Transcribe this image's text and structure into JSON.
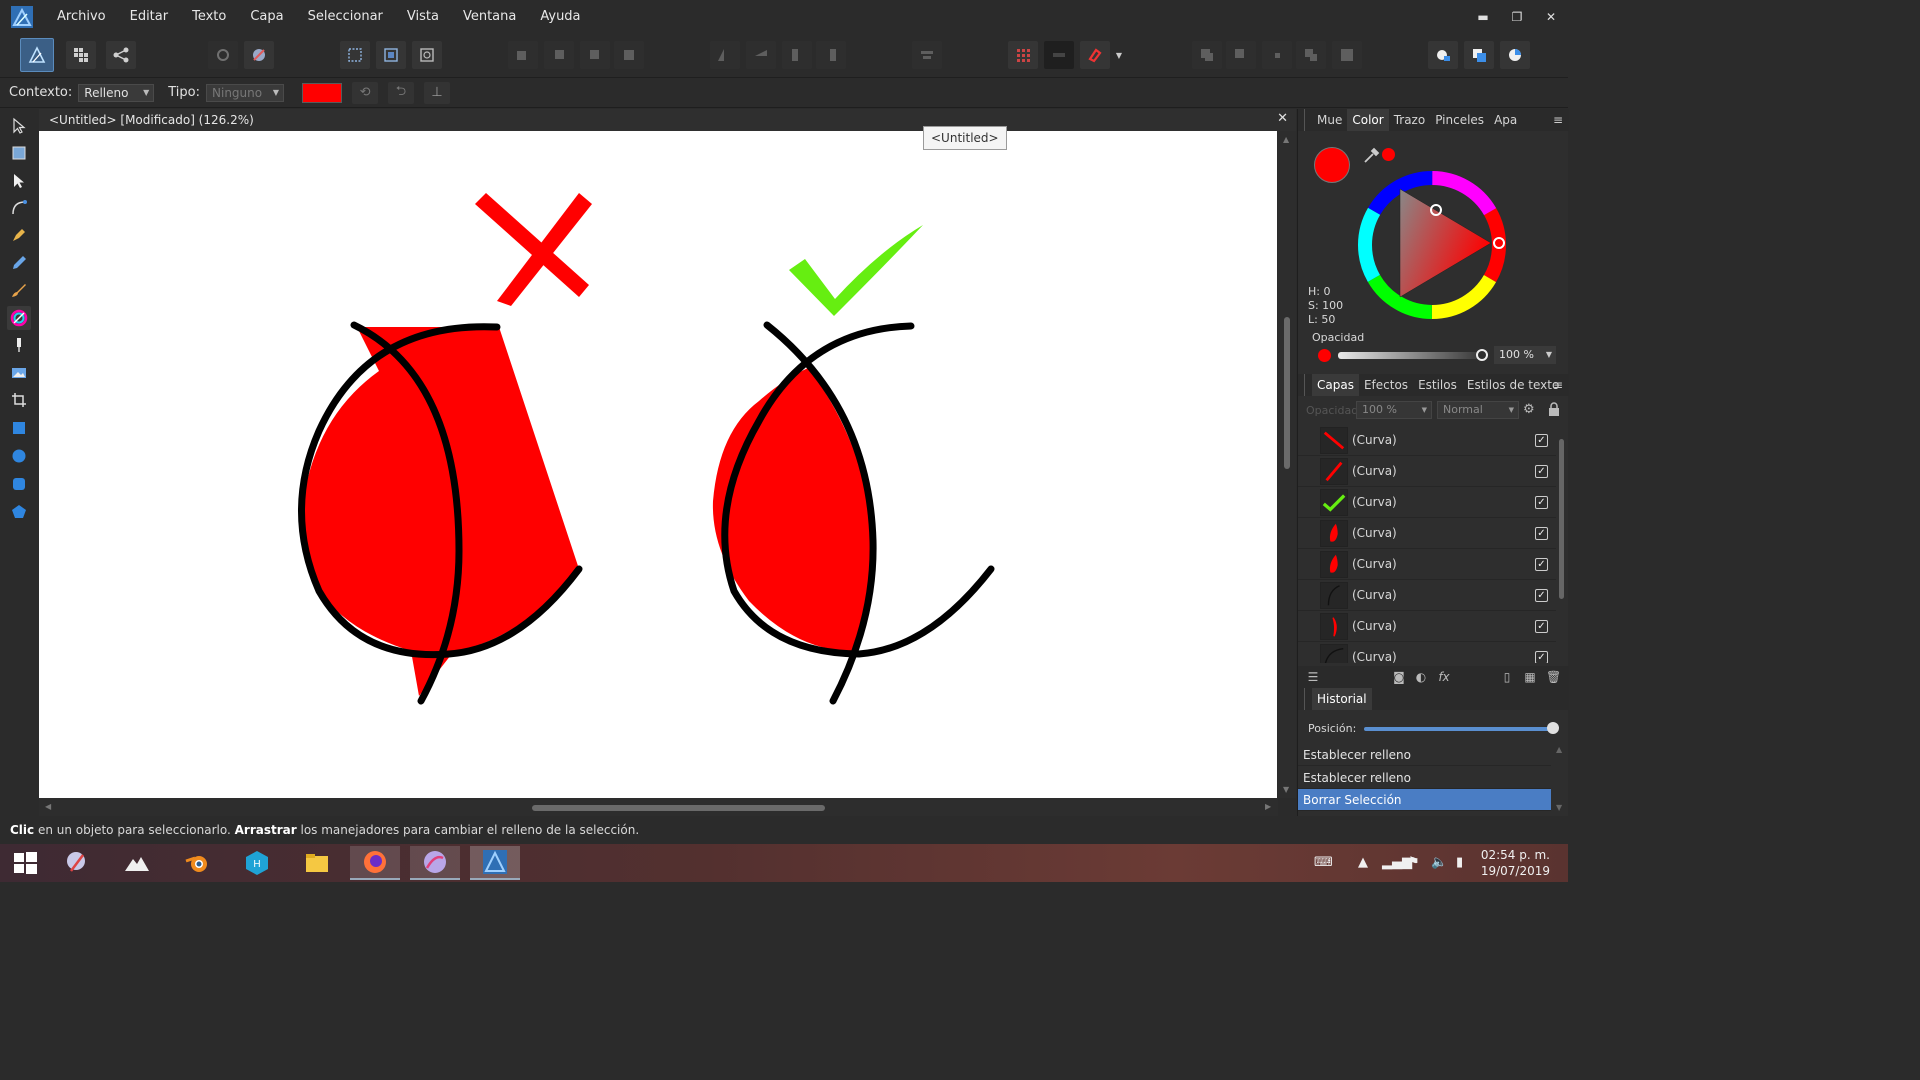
{
  "app": {
    "name": "Affinity Designer"
  },
  "menu": {
    "items": [
      "Archivo",
      "Editar",
      "Texto",
      "Capa",
      "Seleccionar",
      "Vista",
      "Ventana",
      "Ayuda"
    ]
  },
  "window_controls": {
    "minimize": "▬",
    "restore": "❐",
    "close": "✕"
  },
  "context_bar": {
    "context_label": "Contexto:",
    "context_value": "Relleno",
    "type_label": "Tipo:",
    "type_value": "Ninguno",
    "fill_color": "#ff0000"
  },
  "document": {
    "title": "<Untitled> [Modificado] (126.2%)",
    "close": "✕",
    "tooltip": "<Untitled>"
  },
  "color_panel": {
    "tabs": [
      "Mue",
      "Color",
      "Trazo",
      "Pinceles",
      "Apa"
    ],
    "active_tab": "Color",
    "h": "H: 0",
    "s": "S: 100",
    "l": "L: 50",
    "opacity_label": "Opacidad",
    "opacity_value": "100 %",
    "color": "#ff0000"
  },
  "layers_panel": {
    "tabs": [
      "Capas",
      "Efectos",
      "Estilos",
      "Estilos de texto"
    ],
    "active_tab": "Capas",
    "opacity_label": "Opacidad:",
    "opacity_value": "100 %",
    "blend_mode": "Normal",
    "layers": [
      {
        "name": "(Curva)",
        "thumb": "red-slash-1",
        "visible": "✓"
      },
      {
        "name": "(Curva)",
        "thumb": "red-slash-2",
        "visible": "✓"
      },
      {
        "name": "(Curva)",
        "thumb": "green-check",
        "visible": "✓"
      },
      {
        "name": "(Curva)",
        "thumb": "red-leaf",
        "visible": "✓"
      },
      {
        "name": "(Curva)",
        "thumb": "red-leaf",
        "visible": "✓"
      },
      {
        "name": "(Curva)",
        "thumb": "black-curve",
        "visible": "✓"
      },
      {
        "name": "(Curva)",
        "thumb": "red-sliver",
        "visible": "✓"
      },
      {
        "name": "(Curva)",
        "thumb": "black-curve",
        "visible": "✓"
      }
    ]
  },
  "history_panel": {
    "tab": "Historial",
    "position_label": "Posición:",
    "items": [
      {
        "label": "Establecer relleno",
        "selected": false
      },
      {
        "label": "Establecer relleno",
        "selected": false
      },
      {
        "label": "Borrar Selección",
        "selected": true
      }
    ]
  },
  "status": {
    "bold1": "Clic",
    "text1": " en un objeto para seleccionarlo. ",
    "bold2": "Arrastrar",
    "text2": " los manejadores para cambiar el relleno de la selección."
  },
  "taskbar": {
    "time": "02:54 p. m.",
    "date": "19/07/2019"
  },
  "colors": {
    "red": "#ff0000",
    "green": "#66ee11",
    "accent": "#4a7dc4"
  }
}
